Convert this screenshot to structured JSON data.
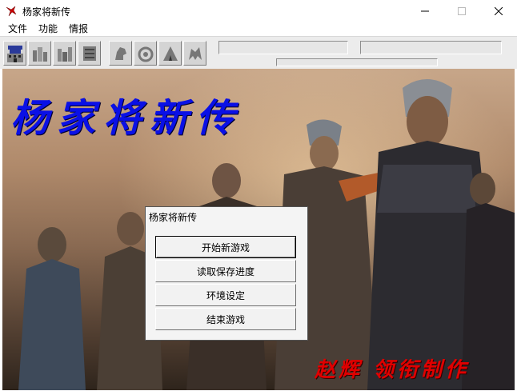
{
  "window": {
    "title": "杨家将新传",
    "icon": "red-bird-icon"
  },
  "menu": {
    "items": [
      {
        "label": "文件"
      },
      {
        "label": "功能"
      },
      {
        "label": "情报"
      }
    ]
  },
  "toolbar": {
    "buttons": [
      {
        "icon": "castle-icon"
      },
      {
        "icon": "mountain-icon"
      },
      {
        "icon": "mountain-alt-icon"
      },
      {
        "icon": "scroll-icon"
      },
      {
        "icon": "horse-icon"
      },
      {
        "icon": "swirl-icon"
      },
      {
        "icon": "tent-icon"
      },
      {
        "icon": "dragon-icon"
      }
    ]
  },
  "game": {
    "title": "杨家将新传",
    "credit": "赵辉 领衔制作",
    "title_color": "#0a10e6",
    "credit_color": "#e00000"
  },
  "dialog": {
    "title": "杨家将新传",
    "buttons": [
      {
        "label": "开始新游戏"
      },
      {
        "label": "读取保存进度"
      },
      {
        "label": "环境设定"
      },
      {
        "label": "结束游戏"
      }
    ]
  }
}
